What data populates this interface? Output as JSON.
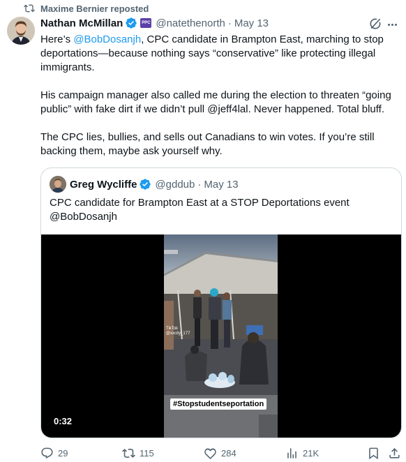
{
  "repost": {
    "label": "Maxime Bernier reposted"
  },
  "tweet": {
    "author_name": "Nathan McMillan",
    "handle": "@natethenorth",
    "separator": "·",
    "date": "May 13",
    "affiliate_badge": "PPC",
    "p1_pre": "Here’s ",
    "p1_mention": "@BobDosanjh",
    "p1_post": ", CPC candidate in Brampton East, marching to stop deportations—because nothing says “conservative” like protecting illegal immigrants.",
    "p2": "His campaign manager also called me during the election to threaten “going public” with fake dirt if we didn’t pull @jeff4lal. Never happened. Total bluff.",
    "p3": "The CPC lies, bullies, and sells out Canadians to win votes. If you’re still backing them, maybe ask yourself why."
  },
  "quote": {
    "author_name": "Greg Wycliffe",
    "handle": "@gddub",
    "separator": "·",
    "date": "May 13",
    "text": "CPC candidate for Brampton East at a STOP Deportations event @BobDosanjh",
    "video": {
      "caption": "#Stopstudentseportation",
      "watermark_line1": "TikTok",
      "watermark_line2": "@xxcity_177",
      "duration": "0:32"
    }
  },
  "actions": {
    "replies": "29",
    "reposts": "115",
    "likes": "284",
    "views": "21K"
  },
  "colors": {
    "accent": "#1d9bf0",
    "text": "#0f1419",
    "muted": "#536471",
    "border": "#cfd9de",
    "verified": "#1d9bf0"
  }
}
